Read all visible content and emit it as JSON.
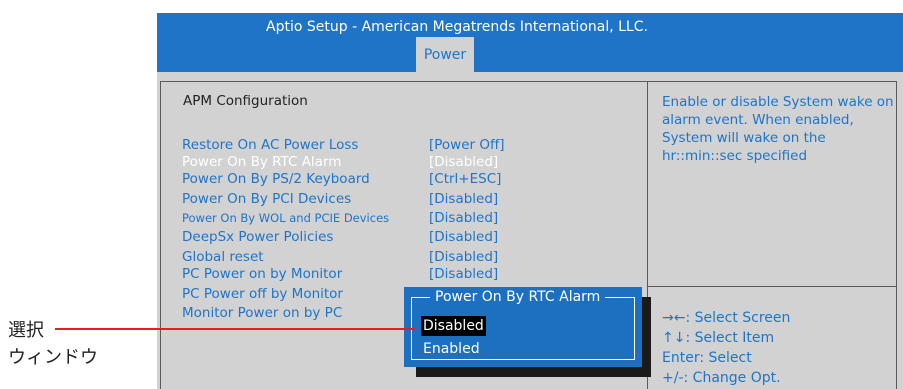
{
  "header": {
    "title": "Aptio Setup - American Megatrends International, LLC.",
    "tab": "Power"
  },
  "section": {
    "title": "APM  Configuration"
  },
  "items": [
    {
      "label": "Restore On AC Power Loss",
      "value": "[Power Off]"
    },
    {
      "label": "Power On By RTC Alarm",
      "value": "[Disabled]"
    },
    {
      "label": "Power On By PS/2 Keyboard",
      "value": "[Ctrl+ESC]"
    },
    {
      "label": "Power On By PCI Devices",
      "value": "[Disabled]"
    },
    {
      "label": "Power On By WOL and PCIE Devices",
      "value": "[Disabled]"
    },
    {
      "label": "DeepSx Power Policies",
      "value": "[Disabled]"
    },
    {
      "label": "Global reset",
      "value": "[Disabled]"
    },
    {
      "label": "PC Power on by Monitor",
      "value": "[Disabled]"
    },
    {
      "label": "PC Power off by Monitor",
      "value": ""
    },
    {
      "label": "Monitor Power on by PC",
      "value": ""
    }
  ],
  "help": {
    "text": "Enable or disable System wake on alarm event. When enabled, System will wake on the hr::min::sec specified"
  },
  "keys": [
    "→←: Select Screen",
    "↑↓: Select Item",
    "Enter: Select",
    "+/-: Change Opt."
  ],
  "popup": {
    "title": "Power On By RTC Alarm",
    "options": [
      "Disabled",
      "Enabled"
    ]
  },
  "callout": {
    "line1": "選択",
    "line2": "ウィンドウ"
  },
  "colors": {
    "header_bg": "#1f74c7",
    "panel_bg": "#d2d2d2",
    "item_text": "#1f74c7",
    "popup_bg": "#1d6fc0",
    "callout_line": "#e32020"
  }
}
